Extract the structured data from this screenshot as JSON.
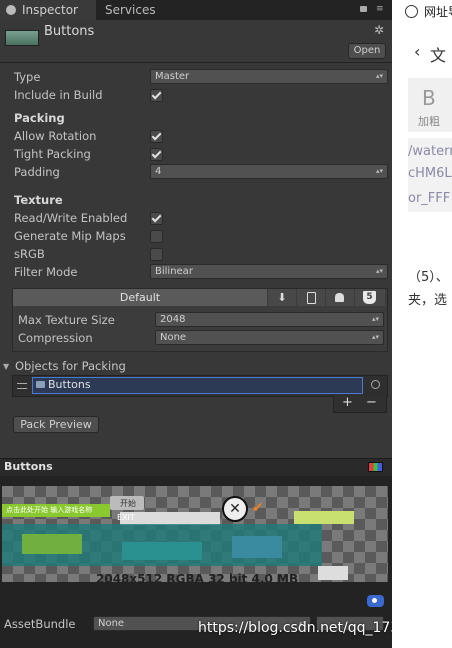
{
  "tabs": {
    "inspector": "Inspector",
    "services": "Services"
  },
  "asset": {
    "name": "Buttons",
    "open_label": "Open"
  },
  "fields": {
    "type_label": "Type",
    "type_value": "Master",
    "include_label": "Include in Build",
    "include_checked": true
  },
  "packing": {
    "header": "Packing",
    "allow_rotation_label": "Allow Rotation",
    "allow_rotation_checked": true,
    "tight_packing_label": "Tight Packing",
    "tight_packing_checked": true,
    "padding_label": "Padding",
    "padding_value": "4"
  },
  "texture": {
    "header": "Texture",
    "read_write_label": "Read/Write Enabled",
    "read_write_checked": true,
    "mipmaps_label": "Generate Mip Maps",
    "mipmaps_checked": false,
    "srgb_label": "sRGB",
    "srgb_checked": false,
    "filter_label": "Filter Mode",
    "filter_value": "Bilinear"
  },
  "platform": {
    "default_label": "Default",
    "max_size_label": "Max Texture Size",
    "max_size_value": "2048",
    "compression_label": "Compression",
    "compression_value": "None"
  },
  "objects": {
    "header": "Objects for Packing",
    "item_label": "Buttons",
    "add_label": "+",
    "remove_label": "−",
    "pack_preview_label": "Pack Preview"
  },
  "preview": {
    "title": "Buttons",
    "info": "2048x512 RGBA 32 bit   4.0 MB",
    "sprite_text_1": "点击此处开始 输入游戏名称",
    "sprite_text_2": "开始",
    "sprite_text_3": "EXIT"
  },
  "asset_bundle": {
    "label": "AssetBundle",
    "value": "None"
  },
  "watermark": "https://blog.csdn.net/qq_17367039",
  "right_panel": {
    "title": "网址导",
    "back_text": "文",
    "bold_letter": "B",
    "bold_caption": "加粗",
    "line1": "/watern",
    "line2": "cHM6L",
    "line3": "or_FFF",
    "para1": "（5）、",
    "para2": "夹，选"
  },
  "colors": {
    "accent": "#4a7bd0",
    "panel": "#383838",
    "check_orange": "#f08020"
  }
}
